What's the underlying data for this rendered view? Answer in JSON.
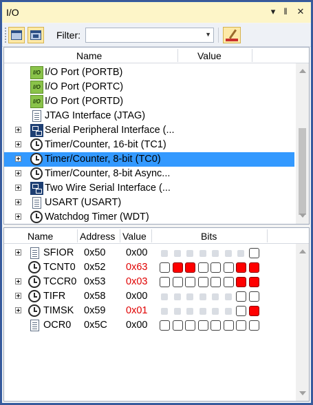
{
  "window": {
    "title": "I/O",
    "buttons": {
      "dropdown": "▾",
      "pin": "📌",
      "close": "✕"
    }
  },
  "toolbar": {
    "filter_label": "Filter:",
    "filter_value": "",
    "view_button_1_icon": "window-layout-icon",
    "view_button_2_icon": "window-detail-icon",
    "clear_filter_icon": "eraser-icon"
  },
  "modules_pane": {
    "headers": {
      "name": "Name",
      "value": "Value"
    },
    "rows": [
      {
        "label": "I/O Port (PORTB)",
        "icon": "io-port-icon",
        "expandable": false,
        "selected": false
      },
      {
        "label": "I/O Port (PORTC)",
        "icon": "io-port-icon",
        "expandable": false,
        "selected": false
      },
      {
        "label": "I/O Port (PORTD)",
        "icon": "io-port-icon",
        "expandable": false,
        "selected": false
      },
      {
        "label": "JTAG Interface (JTAG)",
        "icon": "document-icon",
        "expandable": false,
        "selected": false
      },
      {
        "label": "Serial Peripheral Interface (...",
        "icon": "network-icon",
        "expandable": true,
        "selected": false
      },
      {
        "label": "Timer/Counter, 16-bit (TC1)",
        "icon": "clock-icon",
        "expandable": true,
        "selected": false
      },
      {
        "label": "Timer/Counter, 8-bit (TC0)",
        "icon": "clock-icon",
        "expandable": true,
        "selected": true
      },
      {
        "label": "Timer/Counter, 8-bit Async...",
        "icon": "clock-icon",
        "expandable": true,
        "selected": false
      },
      {
        "label": "Two Wire Serial Interface (...",
        "icon": "network-icon",
        "expandable": true,
        "selected": false
      },
      {
        "label": "USART (USART)",
        "icon": "document-icon",
        "expandable": true,
        "selected": false
      },
      {
        "label": "Watchdog Timer (WDT)",
        "icon": "clock-icon",
        "expandable": true,
        "selected": false
      }
    ]
  },
  "registers_pane": {
    "headers": {
      "name": "Name",
      "address": "Address",
      "value": "Value",
      "bits": "Bits"
    },
    "rows": [
      {
        "name": "SFIOR",
        "address": "0x50",
        "value": "0x00",
        "changed": false,
        "expandable": true,
        "icon": "document-icon",
        "bits": [
          "na",
          "na",
          "na",
          "na",
          "na",
          "na",
          "na",
          "off"
        ]
      },
      {
        "name": "TCNT0",
        "address": "0x52",
        "value": "0x63",
        "changed": true,
        "expandable": false,
        "icon": "clock-icon",
        "bits": [
          "off",
          "on",
          "on",
          "off",
          "off",
          "off",
          "on",
          "on"
        ]
      },
      {
        "name": "TCCR0",
        "address": "0x53",
        "value": "0x03",
        "changed": true,
        "expandable": true,
        "icon": "clock-icon",
        "bits": [
          "off",
          "off",
          "off",
          "off",
          "off",
          "off",
          "on",
          "on"
        ]
      },
      {
        "name": "TIFR",
        "address": "0x58",
        "value": "0x00",
        "changed": false,
        "expandable": true,
        "icon": "clock-icon",
        "bits": [
          "na",
          "na",
          "na",
          "na",
          "na",
          "na",
          "off",
          "off"
        ]
      },
      {
        "name": "TIMSK",
        "address": "0x59",
        "value": "0x01",
        "changed": true,
        "expandable": true,
        "icon": "clock-icon",
        "bits": [
          "na",
          "na",
          "na",
          "na",
          "na",
          "na",
          "off",
          "on"
        ]
      },
      {
        "name": "OCR0",
        "address": "0x5C",
        "value": "0x00",
        "changed": false,
        "expandable": false,
        "icon": "document-icon",
        "bits": [
          "off",
          "off",
          "off",
          "off",
          "off",
          "off",
          "off",
          "off"
        ]
      }
    ]
  },
  "colors": {
    "selection": "#3399ff",
    "bit_set": "#ff0000",
    "value_changed": "#e00000",
    "titlebar": "#fdf5c8"
  }
}
